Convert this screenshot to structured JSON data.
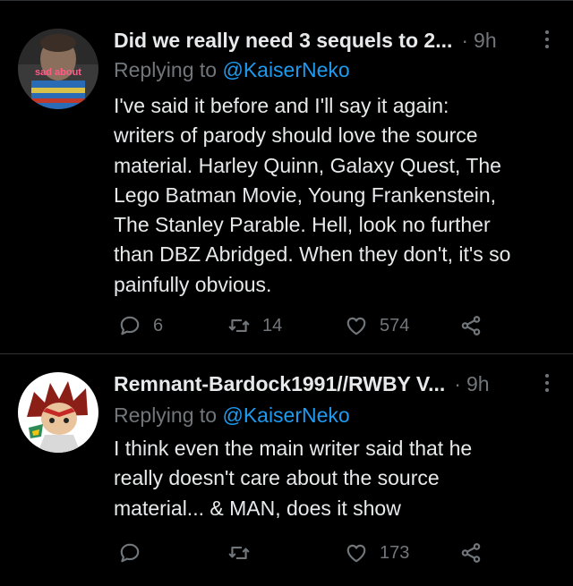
{
  "tweets": [
    {
      "display_name": "Did we really need 3 sequels to 2...",
      "time": "9h",
      "separator": "·",
      "replying_prefix": "Replying to",
      "replying_handle": "@KaiserNeko",
      "avatar_text": "sad about",
      "lines": [
        "I've said it before and I'll say it again:",
        "writers of parody should love the source",
        "material. Harley Quinn, Galaxy Quest, The",
        "Lego Batman Movie, Young Frankenstein,",
        "The Stanley Parable. Hell, look no further",
        "than DBZ Abridged. When they don't, it's so",
        "painfully obvious."
      ],
      "reply_count": "6",
      "retweet_count": "14",
      "like_count": "574"
    },
    {
      "display_name": "Remnant-Bardock1991//RWBY V...",
      "time": "9h",
      "separator": "·",
      "replying_prefix": "Replying to",
      "replying_handle": "@KaiserNeko",
      "lines": [
        "I think even the main writer said that he",
        "really doesn't care about the source",
        "material... & MAN, does it show"
      ],
      "reply_count": "",
      "retweet_count": "",
      "like_count": "173"
    }
  ],
  "colors": {
    "background": "#000000",
    "text": "#e7e9ea",
    "muted": "#71767b",
    "link": "#1d9bf0",
    "divider": "#2f3336"
  },
  "icons": [
    "reply-icon",
    "retweet-icon",
    "like-icon",
    "share-icon",
    "more-icon"
  ]
}
